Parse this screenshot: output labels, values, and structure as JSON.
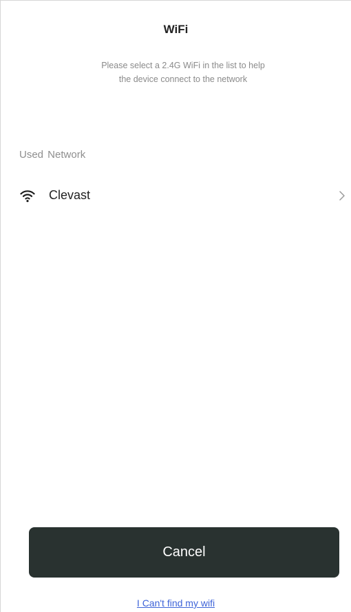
{
  "header": {
    "title": "WiFi",
    "subtitle_line1": "Please select a 2.4G WiFi in the list to help",
    "subtitle_line2": "the device connect to the network"
  },
  "section": {
    "label": "Used Network"
  },
  "networks": [
    {
      "name": "Clevast",
      "icon": "wifi-icon",
      "trailing_icon": "chevron-right-icon"
    }
  ],
  "actions": {
    "cancel_label": "Cancel",
    "cant_find_label": "I Can't find my wifi"
  },
  "colors": {
    "button_bg": "#293230",
    "link": "#3d63d8",
    "muted_text": "#8a8a8a"
  }
}
